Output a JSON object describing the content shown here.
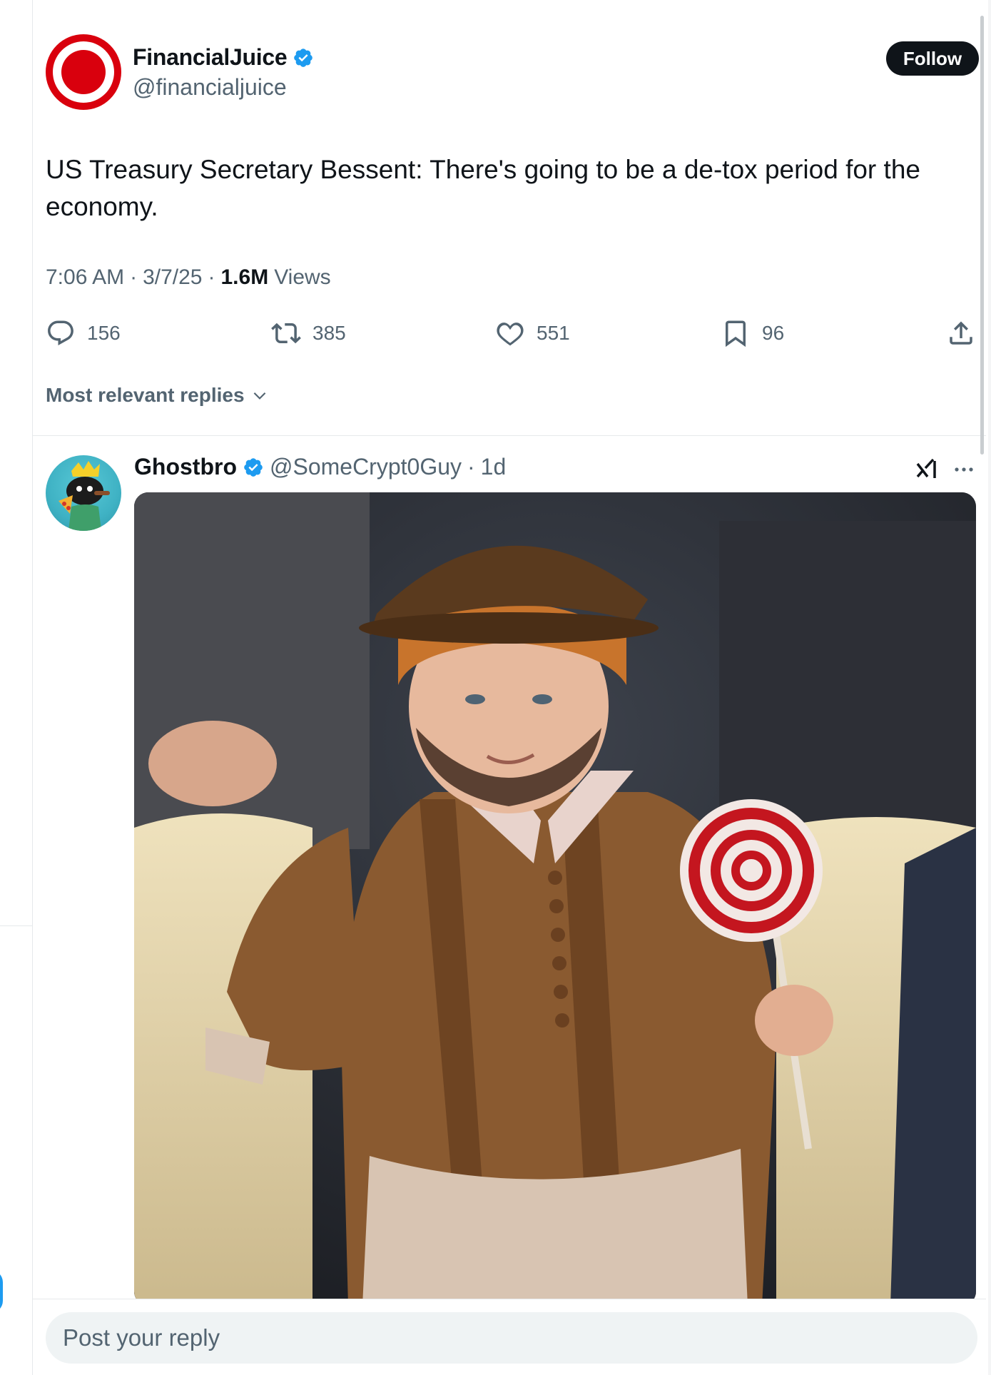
{
  "tweet": {
    "author": {
      "display_name": "FinancialJuice",
      "handle": "@financialjuice",
      "verified": true,
      "avatar": "red-record-circle-logo"
    },
    "follow_label": "Follow",
    "text": "US Treasury Secretary Bessent: There's going to be a de-tox period for the economy.",
    "time": "7:06 AM",
    "date": "3/7/25",
    "views_count": "1.6M",
    "views_label": "Views",
    "stats": {
      "replies": "156",
      "reposts": "385",
      "likes": "551",
      "bookmarks": "96"
    }
  },
  "replies_sort": {
    "label": "Most relevant replies"
  },
  "reply": {
    "display_name": "Ghostbro",
    "handle": "@SomeCrypt0Guy",
    "separator": "·",
    "time": "1d",
    "verified": true,
    "media": "photo-oompa-loompa-costume-with-lollipop"
  },
  "composer": {
    "placeholder": "Post your reply"
  },
  "colors": {
    "accent": "#1d9bf0",
    "text_primary": "#0f1419",
    "text_secondary": "#536471",
    "brand_red": "#d9000d"
  }
}
